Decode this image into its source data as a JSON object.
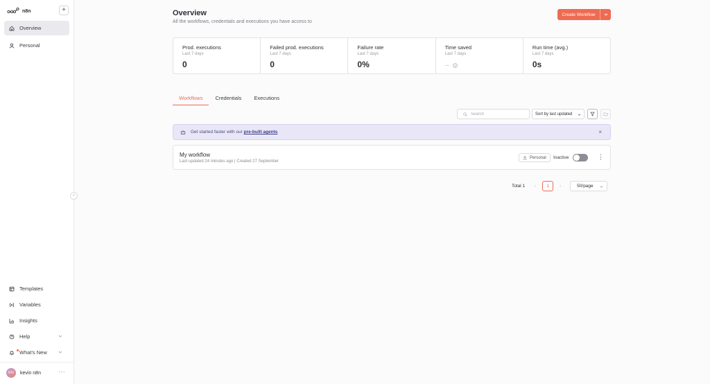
{
  "sidebar": {
    "brand": "n8n",
    "add_label": "+",
    "nav": [
      {
        "label": "Overview",
        "icon": "home-icon"
      },
      {
        "label": "Personal",
        "icon": "user-icon"
      }
    ],
    "bottom": [
      {
        "label": "Templates",
        "icon": "templates-icon"
      },
      {
        "label": "Variables",
        "icon": "variables-icon"
      },
      {
        "label": "Insights",
        "icon": "insights-icon"
      },
      {
        "label": "Help",
        "icon": "help-icon"
      },
      {
        "label": "What's New",
        "icon": "bell-icon"
      }
    ],
    "user": {
      "initials": "KN",
      "name": "kevin n8n",
      "more": "···"
    },
    "collapse_glyph": "‹"
  },
  "header": {
    "title": "Overview",
    "subtitle": "All the workflows, credentials and executions you have access to",
    "create_button": "Create Workflow"
  },
  "stats": [
    {
      "title": "Prod. executions",
      "period": "Last 7 days",
      "value": "0"
    },
    {
      "title": "Failed prod. executions",
      "period": "Last 7 days",
      "value": "0"
    },
    {
      "title": "Failure rate",
      "period": "Last 7 days",
      "value": "0%"
    },
    {
      "title": "Time saved",
      "period": "Last 7 days",
      "value": "--"
    },
    {
      "title": "Run time (avg.)",
      "period": "Last 7 days",
      "value": "0s"
    }
  ],
  "tabs": [
    "Workflows",
    "Credentials",
    "Executions"
  ],
  "toolbar": {
    "search_placeholder": "Search",
    "sort_value": "Sort by last updated"
  },
  "banner": {
    "text": "Get started faster with our",
    "link": "pre-built agents",
    "close": "×"
  },
  "workflows": [
    {
      "name": "My workflow",
      "meta": "Last updated 24 minutes ago | Created 27 September",
      "tag": "Personal",
      "status": "Inactive",
      "active": false
    }
  ],
  "pagination": {
    "total": "Total 1",
    "prev": "‹",
    "page": "1",
    "next": "›",
    "per_page": "50/page"
  },
  "colors": {
    "accent": "#ee6b51",
    "banner_bg": "#e9e7f7"
  }
}
